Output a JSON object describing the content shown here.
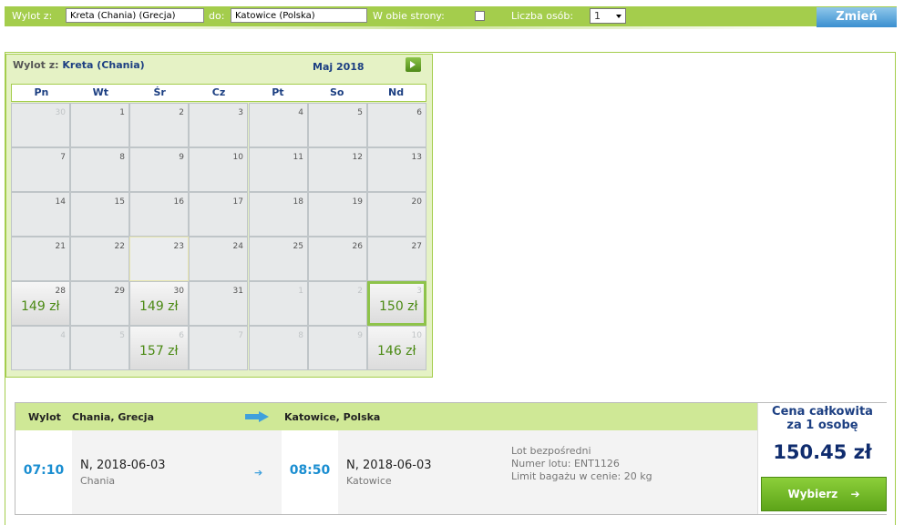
{
  "search": {
    "from_label": "Wylot z:",
    "from_value": "Kreta (Chania) (Grecja)",
    "to_label": "do:",
    "to_value": "Katowice (Polska)",
    "roundtrip_label": "W obie strony:",
    "roundtrip_checked": false,
    "persons_label": "Liczba osób:",
    "persons_value": "1",
    "submit_label": "Zmień"
  },
  "calendar": {
    "title_prefix": "Wylot z:",
    "title_city": "Kreta (Chania)",
    "month": "Maj 2018",
    "weekdays": [
      "Pn",
      "Wt",
      "Śr",
      "Cz",
      "Pt",
      "So",
      "Nd"
    ],
    "days": [
      {
        "n": "30",
        "other": true
      },
      {
        "n": "1"
      },
      {
        "n": "2"
      },
      {
        "n": "3"
      },
      {
        "n": "4"
      },
      {
        "n": "5"
      },
      {
        "n": "6"
      },
      {
        "n": "7"
      },
      {
        "n": "8"
      },
      {
        "n": "9"
      },
      {
        "n": "10"
      },
      {
        "n": "11"
      },
      {
        "n": "12"
      },
      {
        "n": "13"
      },
      {
        "n": "14"
      },
      {
        "n": "15"
      },
      {
        "n": "16"
      },
      {
        "n": "17"
      },
      {
        "n": "18"
      },
      {
        "n": "19"
      },
      {
        "n": "20"
      },
      {
        "n": "21"
      },
      {
        "n": "22"
      },
      {
        "n": "23",
        "today": true
      },
      {
        "n": "24"
      },
      {
        "n": "25"
      },
      {
        "n": "26"
      },
      {
        "n": "27"
      },
      {
        "n": "28",
        "price": "149 zł"
      },
      {
        "n": "29"
      },
      {
        "n": "30",
        "price": "149 zł"
      },
      {
        "n": "31"
      },
      {
        "n": "1",
        "other": true
      },
      {
        "n": "2",
        "other": true
      },
      {
        "n": "3",
        "other": true,
        "price": "150 zł",
        "selected": true
      },
      {
        "n": "4",
        "other": true
      },
      {
        "n": "5",
        "other": true
      },
      {
        "n": "6",
        "other": true,
        "price": "157 zł"
      },
      {
        "n": "7",
        "other": true
      },
      {
        "n": "8",
        "other": true
      },
      {
        "n": "9",
        "other": true
      },
      {
        "n": "10",
        "other": true,
        "price": "146 zł"
      }
    ]
  },
  "flight": {
    "label": "Wylot",
    "from": "Chania, Grecja",
    "to": "Katowice, Polska",
    "dep_time": "07:10",
    "dep_date": "N, 2018-06-03",
    "dep_city": "Chania",
    "arr_time": "08:50",
    "arr_date": "N, 2018-06-03",
    "arr_city": "Katowice",
    "info_type": "Lot bezpośredni",
    "info_number": "Numer lotu: ENT1126",
    "info_baggage": "Limit bagażu w cenie: 20 kg",
    "price_label_1": "Cena całkowita",
    "price_label_2": "za 1 osobę",
    "price_value": "150.45 zł",
    "select_label": "Wybierz"
  },
  "colors": {
    "accent_green": "#a4cd4c",
    "price_green": "#4b8a14",
    "blue": "#1a8ed1",
    "navy": "#1c3f82"
  }
}
